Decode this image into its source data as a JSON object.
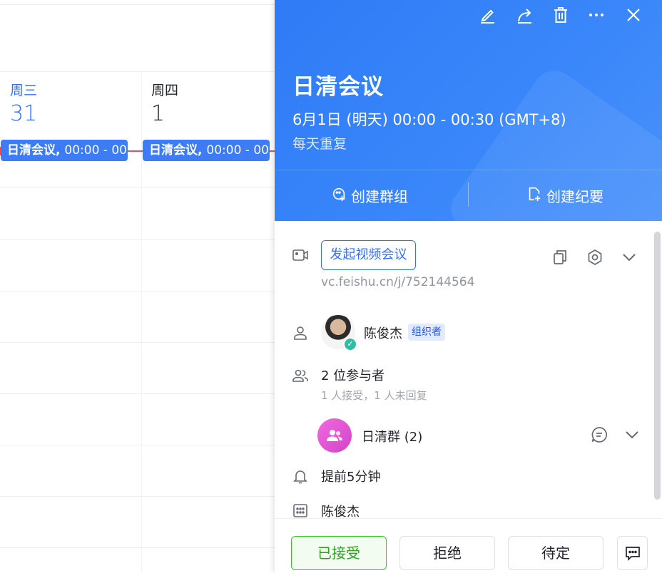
{
  "calendar": {
    "days": [
      {
        "weekday": "周三",
        "date": "31"
      },
      {
        "weekday": "周四",
        "date": "1"
      }
    ],
    "events": [
      {
        "title": "日清会议,",
        "time": "00:00 - 00"
      },
      {
        "title": "日清会议,",
        "time": "00:00 - 00"
      }
    ]
  },
  "panel": {
    "toolbar_icons": [
      "edit-icon",
      "share-icon",
      "delete-icon",
      "more-icon",
      "close-icon"
    ],
    "title": "日清会议",
    "time": "6月1日 (明天) 00:00 - 00:30 (GMT+8)",
    "repeat": "每天重复",
    "actions": {
      "create_group": "创建群组",
      "create_minutes": "创建纪要"
    },
    "video": {
      "button_label": "发起视频会议",
      "link": "vc.feishu.cn/j/752144564"
    },
    "organizer": {
      "name": "陈俊杰",
      "badge": "组织者"
    },
    "attendees": {
      "count_label": "2 位参与者",
      "status": "1 人接受，1 人未回复"
    },
    "group": {
      "name": "日清群 (2)"
    },
    "reminder": "提前5分钟",
    "calendar_owner": "陈俊杰",
    "footer": {
      "accept": "已接受",
      "decline": "拒绝",
      "tentative": "待定"
    }
  },
  "colors": {
    "header_blue": "#3a87fa",
    "event_blue": "#3d7cf4",
    "now_red": "#f54a45",
    "accept_green": "#2ea121",
    "link_blue": "#3370ff"
  }
}
